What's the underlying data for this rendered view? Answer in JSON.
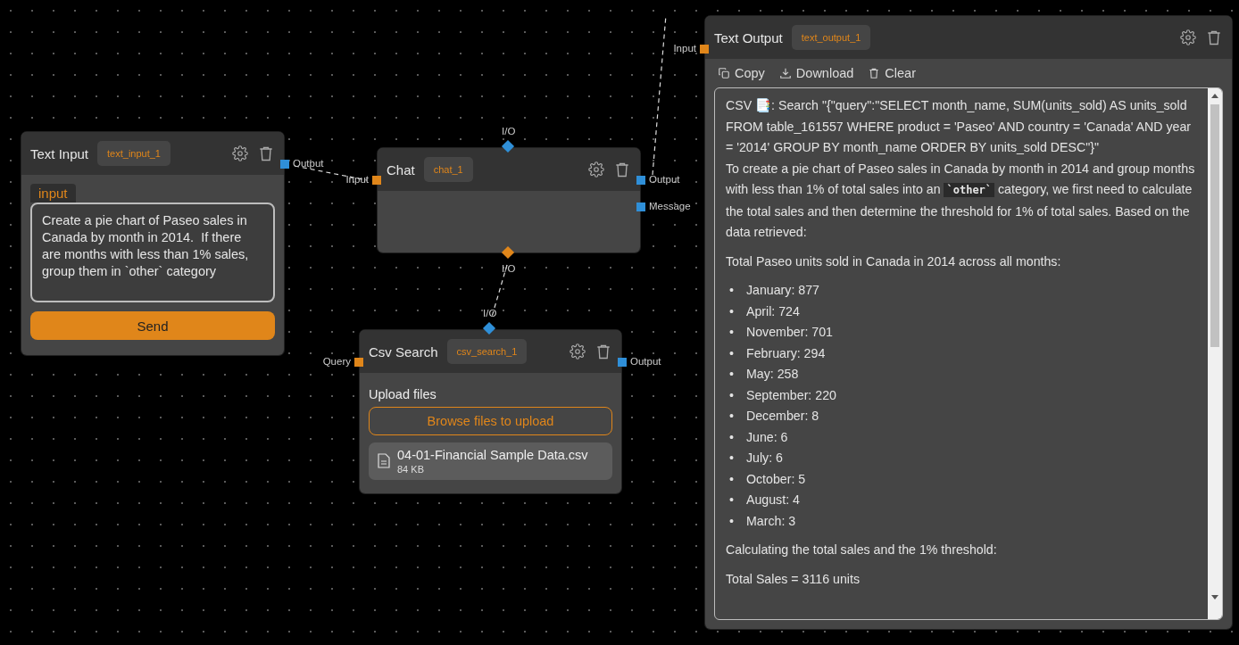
{
  "nodes": [
    {
      "kind": "text_input",
      "title": "Text Input",
      "badge": "text_input_1",
      "ports": [
        {
          "label": "Output",
          "kind": "square",
          "color": "#2f8fd8"
        }
      ],
      "field_label": "input",
      "value": "Create a pie chart of Paseo sales in Canada by month in 2014.  If there are months with less than 1% sales, group them in `other` category",
      "button": "Send"
    },
    {
      "kind": "chat",
      "title": "Chat",
      "badge": "chat_1",
      "ports": [
        {
          "label": "Input",
          "kind": "square",
          "color": "#e0861a"
        },
        {
          "label": "Output",
          "kind": "square",
          "color": "#2f8fd8"
        },
        {
          "label": "Message",
          "kind": "square",
          "color": "#2f8fd8"
        },
        {
          "label": "I/O",
          "kind": "diamond",
          "color": "#2f8fd8"
        },
        {
          "label": "I/O",
          "kind": "diamond",
          "color": "#e0861a"
        }
      ]
    },
    {
      "kind": "csv_search",
      "title": "Csv Search",
      "badge": "csv_search_1",
      "ports": [
        {
          "label": "Query",
          "kind": "square",
          "color": "#e0861a"
        },
        {
          "label": "Output",
          "kind": "square",
          "color": "#2f8fd8"
        },
        {
          "label": "I/O",
          "kind": "diamond",
          "color": "#2f8fd8"
        }
      ],
      "upload_label": "Upload files",
      "browse_button": "Browse files to upload",
      "file": {
        "name": "04-01-Financial Sample Data.csv",
        "size": "84 KB"
      }
    },
    {
      "kind": "text_output",
      "title": "Text Output",
      "badge": "text_output_1",
      "ports": [
        {
          "label": "Input",
          "kind": "square",
          "color": "#e0861a"
        }
      ],
      "actions": [
        {
          "kind": "copy",
          "label": "Copy"
        },
        {
          "kind": "download",
          "label": "Download"
        },
        {
          "kind": "clear",
          "label": "Clear"
        }
      ],
      "content": [
        {
          "kind": "para",
          "text": "CSV 📑: Search \"{\"query\":\"SELECT month_name, SUM(units_sold) AS units_sold FROM table_161557 WHERE product = 'Paseo' AND country = 'Canada' AND year = '2014' GROUP BY month_name ORDER BY units_sold DESC\"}\""
        },
        {
          "kind": "para",
          "text": "To create a pie chart of Paseo sales in Canada by month in 2014 and group months with less than 1% of total sales into an ",
          "code": "`other`",
          "after": " category, we first need to calculate the total sales and then determine the threshold for 1% of total sales. Based on the data retrieved:"
        },
        {
          "kind": "para",
          "text": "Total Paseo units sold in Canada in 2014 across all months:"
        },
        {
          "kind": "list",
          "bullet": "•",
          "items": [
            "January: 877",
            "April: 724",
            "November: 701",
            "February: 294",
            "May: 258",
            "September: 220",
            "December: 8",
            "June: 6",
            "July: 6",
            "October: 5",
            "August: 4",
            "March: 3"
          ]
        },
        {
          "kind": "para",
          "text": "Calculating the total sales and the 1% threshold:"
        },
        {
          "kind": "para",
          "text": "Total Sales = 3116 units"
        }
      ]
    }
  ]
}
